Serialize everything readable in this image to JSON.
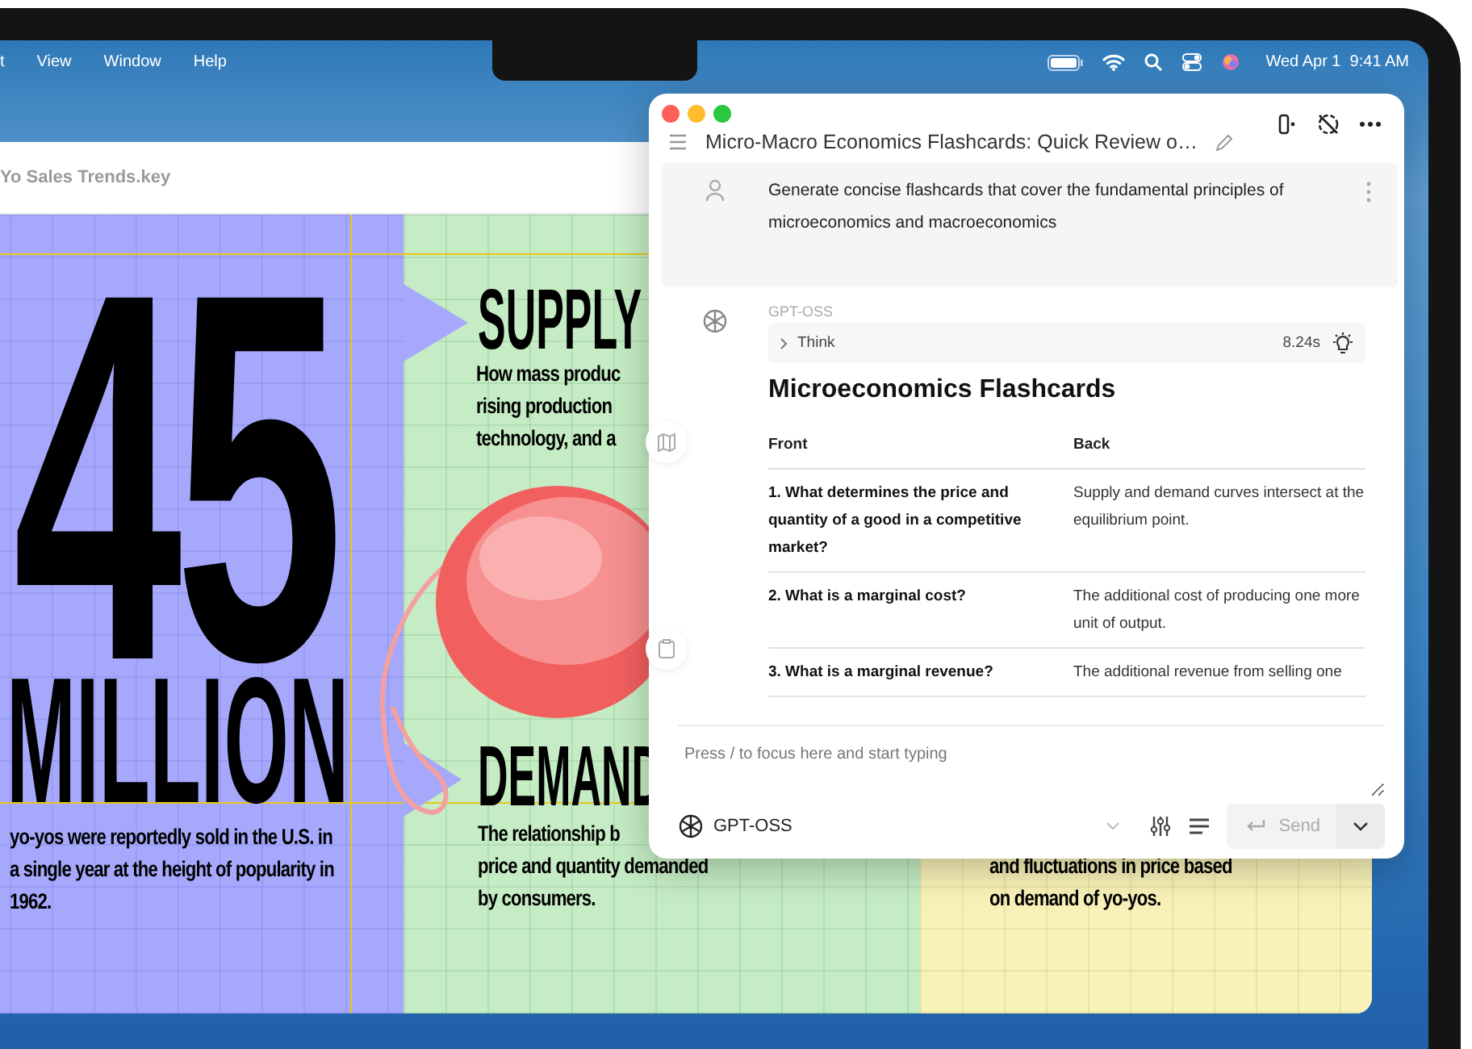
{
  "menu_bar": {
    "items": [
      "t",
      "View",
      "Window",
      "Help"
    ],
    "clock": "Wed Apr 1  9:41 AM"
  },
  "background_window": {
    "title": "Yo Sales Trends.key",
    "slide": {
      "big_number": "45",
      "big_unit": "MILLION",
      "stat_caption": "yo-yos were reportedly sold in the U.S. in a single year at the height of popularity in 1962.",
      "supply_heading": "SUPPLY",
      "supply_lines": [
        "How mass produc",
        "rising production",
        "technology, and a"
      ],
      "demand_heading": "DEMAND",
      "demand_lines": [
        "The relationship b",
        "price and quantity demanded",
        "by consumers."
      ],
      "third_lines": [
        "and fluctuations in price based",
        "on demand of yo-yos."
      ]
    }
  },
  "chat_window": {
    "title": "Micro-Macro Economics Flashcards: Quick Review o…",
    "user_message": "Generate concise flashcards that cover the fundamental principles of microeconomics and macroeconomics",
    "assistant": {
      "model_label": "GPT-OSS",
      "think": {
        "label": "Think",
        "expanded": false,
        "duration": "8.24s"
      },
      "heading": "Microeconomics Flashcards",
      "table": {
        "columns": [
          "Front",
          "Back"
        ],
        "rows": [
          [
            "1. What determines the price and quantity of a good in a competitive market?",
            "Supply and demand curves intersect at the equilibrium point."
          ],
          [
            "2. What is a marginal cost?",
            "The additional cost of producing one more unit of output."
          ],
          [
            "3. What is a marginal revenue?",
            "The additional revenue from selling one"
          ]
        ]
      }
    },
    "composer": {
      "placeholder": "Press / to focus here and start typing",
      "model": "GPT-OSS",
      "send_label": "Send",
      "send_disabled": true
    }
  }
}
